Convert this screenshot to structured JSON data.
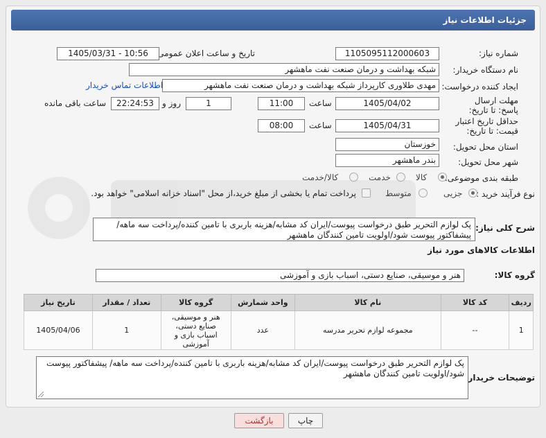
{
  "header": {
    "title": "جزئیات اطلاعات نیاز"
  },
  "fields": {
    "need_number": {
      "label": "شماره نیاز:",
      "value": "1105095112000603"
    },
    "announce": {
      "label": "تاریخ و ساعت اعلان عمومی:",
      "value": "1405/03/31 - 10:56"
    },
    "buyer_org": {
      "label": "نام دستگاه خریدار:",
      "value": "شبکه بهداشت و درمان صنعت نفت ماهشهر"
    },
    "requester": {
      "label": "ایجاد کننده درخواست:",
      "value": "مهدی طلاوری کارپرداز شبکه بهداشت و درمان صنعت نفت ماهشهر",
      "contact_link": "اطلاعات تماس خریدار"
    },
    "reply_deadline": {
      "label": "مهلت ارسال پاسخ: تا تاریخ:",
      "date": "1405/04/02",
      "time_label": "ساعت",
      "time": "11:00",
      "days": "1",
      "days_label": "روز و",
      "remaining": "22:24:53",
      "remaining_label": "ساعت باقی مانده"
    },
    "price_validity": {
      "label": "حداقل تاریخ اعتبار قیمت: تا تاریخ:",
      "date": "1405/04/31",
      "time_label": "ساعت",
      "time": "08:00"
    },
    "province": {
      "label": "استان محل تحویل:",
      "value": "خوزستان"
    },
    "city": {
      "label": "شهر محل تحویل:",
      "value": "بندر ماهشهر"
    },
    "category": {
      "label": "طبقه بندی موضوعی:",
      "options": [
        "کالا",
        "خدمت",
        "کالا/خدمت"
      ],
      "selected": "کالا"
    },
    "process": {
      "label": "نوع فرآیند خرید :",
      "options": [
        "جزیی",
        "متوسط"
      ],
      "selected": "جزیی",
      "payment_note": "پرداخت تمام یا بخشی از مبلغ خرید،از محل \"اسناد خزانه اسلامی\" خواهد بود."
    }
  },
  "description": {
    "label": "شرح کلی نیاز:",
    "text": "پک لوازم التحریر طبق درخواست پیوست/ایران کد مشابه/هزینه باربری با تامین کننده/پرداخت سه ماهه/پیشفاکتور پیوست شود/اولویت تامین کنندگان ماهشهر"
  },
  "goods_section": {
    "title": "اطلاعات کالاهای مورد نیاز"
  },
  "goods_group": {
    "label": "گروه کالا:",
    "value": "هنر و موسیقی، صنایع دستی، اسباب بازی و آموزشی"
  },
  "table": {
    "headers": [
      "ردیف",
      "کد کالا",
      "نام کالا",
      "واحد شمارش",
      "گروه کالا",
      "تعداد / مقدار",
      "تاریخ نیاز"
    ],
    "rows": [
      [
        "1",
        "--",
        "مجموعه لوازم تحریر مدرسه",
        "عدد",
        "هنر و موسیقی، صنایع دستی، اسباب بازی و آموزشی",
        "1",
        "1405/04/06"
      ]
    ]
  },
  "buyer_notes": {
    "label": "توضیحات خریدار:",
    "text": "پک لوازم التحریر طبق درخواست پیوست/ایران کد مشابه/هزینه باربری با تامین کننده/پرداخت سه ماهه/ پیشفاکتور پیوست شود/اولویت تامین کنندگان ماهشهر"
  },
  "buttons": {
    "print": "چاپ",
    "back": "بازگشت"
  },
  "colors": {
    "header": "#3c5f9a",
    "link": "#1a4fb5",
    "back_button": "#f9dede"
  }
}
